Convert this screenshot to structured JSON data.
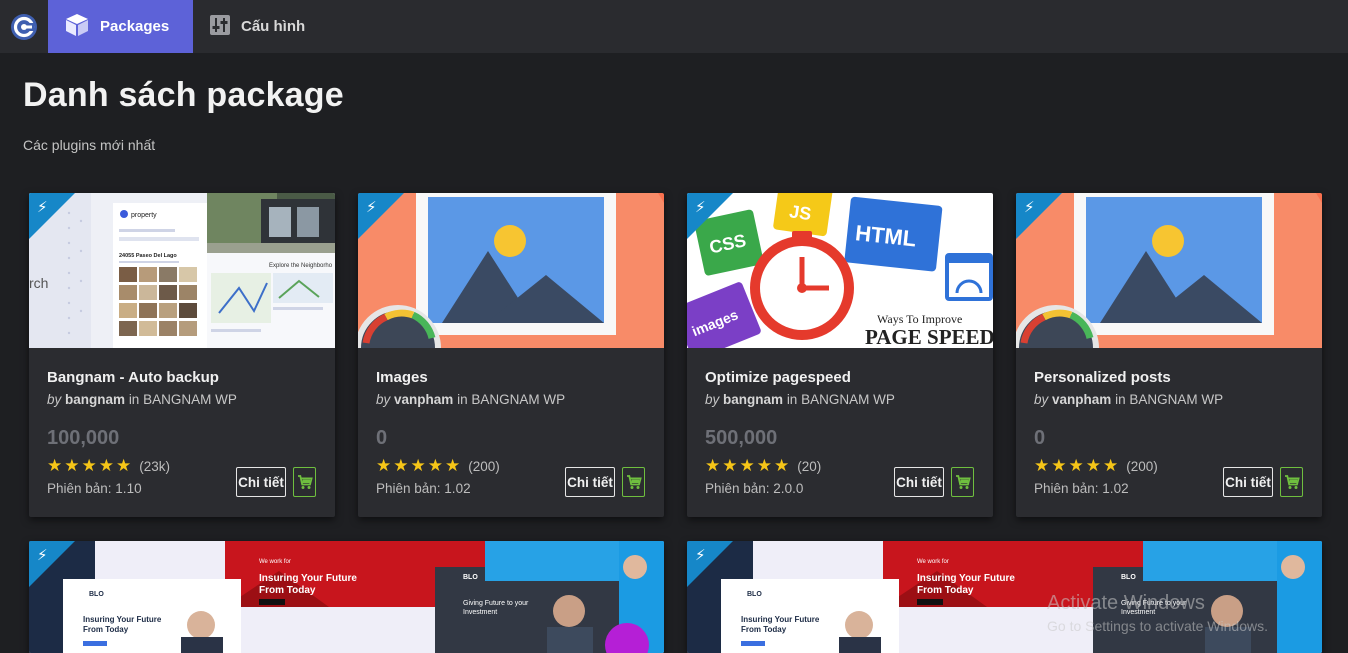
{
  "nav": {
    "logo_icon": "app-logo-icon",
    "items": [
      {
        "label": "Packages",
        "icon": "box-icon",
        "active": true
      },
      {
        "label": "Cấu hình",
        "icon": "settings-sliders-icon",
        "active": false
      }
    ],
    "accent": "#5d62d8"
  },
  "page": {
    "title": "Danh sách package",
    "subtitle": "Các plugins mới nhất"
  },
  "cards": [
    {
      "title": "Bangnam - Auto backup",
      "by": "by",
      "author": "bangnam",
      "in": "in",
      "org": "BANGNAM WP",
      "price": "100,000",
      "stars": "★★★★★",
      "rating_count": "(23k)",
      "version": "Phiên bản: 1.10",
      "detail_label": "Chi tiết"
    },
    {
      "title": "Images",
      "by": "by",
      "author": "vanpham",
      "in": "in",
      "org": "BANGNAM WP",
      "price": "0",
      "stars": "★★★★★",
      "rating_count": "(200)",
      "version": "Phiên bản: 1.02",
      "detail_label": "Chi tiết"
    },
    {
      "title": "Optimize pagespeed",
      "by": "by",
      "author": "bangnam",
      "in": "in",
      "org": "BANGNAM WP",
      "price": "500,000",
      "stars": "★★★★★",
      "rating_count": "(20)",
      "version": "Phiên bản: 2.0.0",
      "detail_label": "Chi tiết"
    },
    {
      "title": "Personalized posts",
      "by": "by",
      "author": "vanpham",
      "in": "in",
      "org": "BANGNAM WP",
      "price": "0",
      "stars": "★★★★★",
      "rating_count": "(200)",
      "version": "Phiên bản: 1.02",
      "detail_label": "Chi tiết"
    }
  ],
  "thumb_text": {
    "property_brand": "property",
    "property_addr": "24055 Paseo Del Lago",
    "property_explore": "Explore the Neighborho",
    "property_search": "rch",
    "speed_css": "CSS",
    "speed_js": "JS",
    "speed_html": "HTML",
    "speed_images": "images",
    "speed_ways": "Ways To Improve",
    "speed_page": "PAGE SPEED",
    "ins_small": "We work for",
    "ins_heading1": "Insuring Your Future",
    "ins_heading2": "From Today",
    "ins_brand": "BLO",
    "ins_giving1": "Giving Future to your",
    "ins_giving2": "Investment",
    "ins_hero1": "Insuring Your Future",
    "ins_hero2": "From Today"
  },
  "watermark": {
    "line1": "Activate Windows",
    "line2": "Go to Settings to activate Windows."
  },
  "colors": {
    "background": "#1e1f22",
    "topbar": "#2a2b2f",
    "card": "#2b2c30",
    "badge": "#1687c8",
    "star": "#f5c518",
    "cart": "#6fbf3f"
  }
}
